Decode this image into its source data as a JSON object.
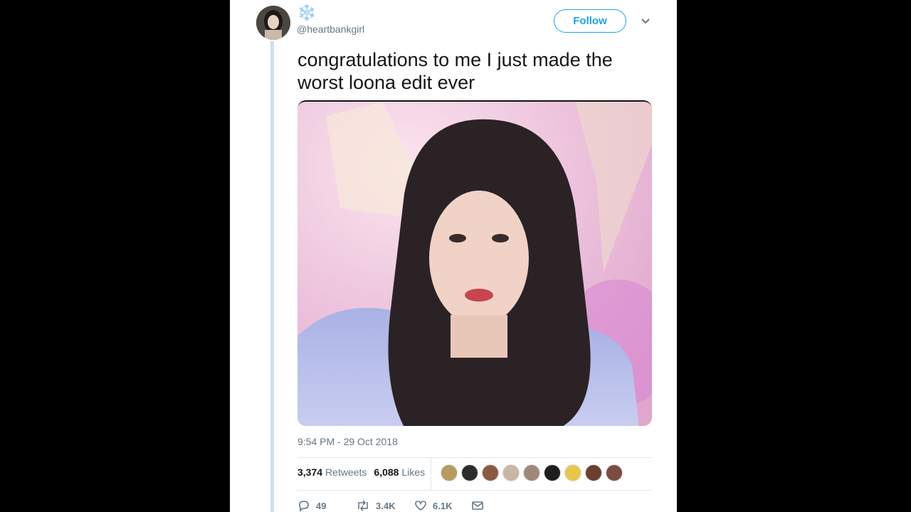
{
  "tweet": {
    "display_name_icon": "snowflake-emoji",
    "display_name": "❄️",
    "handle": "@heartbankgirl",
    "follow_label": "Follow",
    "text": "congratulations to me I just made the worst loona edit ever",
    "timestamp": "9:54 PM - 29 Oct 2018",
    "retweets_count": "3,374",
    "retweets_label": "Retweets",
    "likes_count": "6,088",
    "likes_label": "Likes",
    "actions": {
      "reply_count": "49",
      "retweet_count": "3.4K",
      "like_count": "6.1K"
    }
  },
  "colors": {
    "accent": "#1da1f2",
    "thread_line": "#c8e0ee",
    "muted_text": "#657786"
  }
}
